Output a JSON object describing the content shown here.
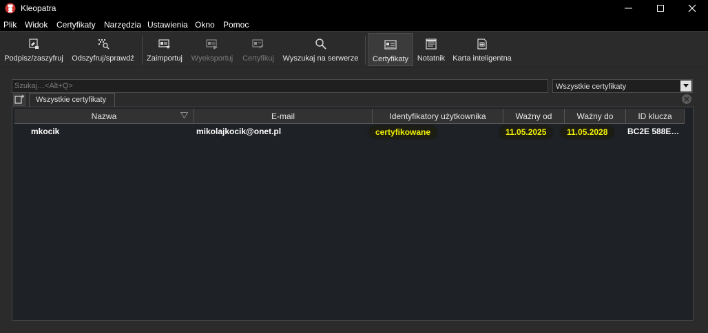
{
  "window": {
    "title": "Kleopatra"
  },
  "menu": [
    "Plik",
    "Widok",
    "Certyfikaty",
    "Narzędzia",
    "Ustawienia",
    "Okno",
    "Pomoc"
  ],
  "toolbar": {
    "sign_encrypt": "Podpisz/zaszyfruj",
    "decrypt_verify": "Odszyfruj/sprawdź",
    "import": "Zaimportuj",
    "export": "Wyeksportuj",
    "certify": "Certyfikuj",
    "lookup_server": "Wyszukaj na serwerze",
    "certificates": "Certyfikaty",
    "notepad": "Notatnik",
    "smartcards": "Karta inteligentna"
  },
  "search": {
    "placeholder": "Szukaj…<Alt+Q>"
  },
  "filter": {
    "selected": "Wszystkie certyfikaty"
  },
  "tabs": [
    {
      "label": "Wszystkie certyfikaty"
    }
  ],
  "table": {
    "columns": [
      "Nazwa",
      "E-mail",
      "Identyfikatory użytkownika",
      "Ważny od",
      "Ważny do",
      "ID klucza"
    ],
    "rows": [
      {
        "name": "mkocik",
        "email": "mikolajkocik@onet.pl",
        "user_ids": "certyfikowane",
        "valid_from": "11.05.2025",
        "valid_until": "11.05.2028",
        "key_id": "BC2E 588E…"
      }
    ]
  },
  "colors": {
    "highlight_text": "#f2f200",
    "titlebar": "#000000",
    "accent_red": "#d0312d"
  }
}
